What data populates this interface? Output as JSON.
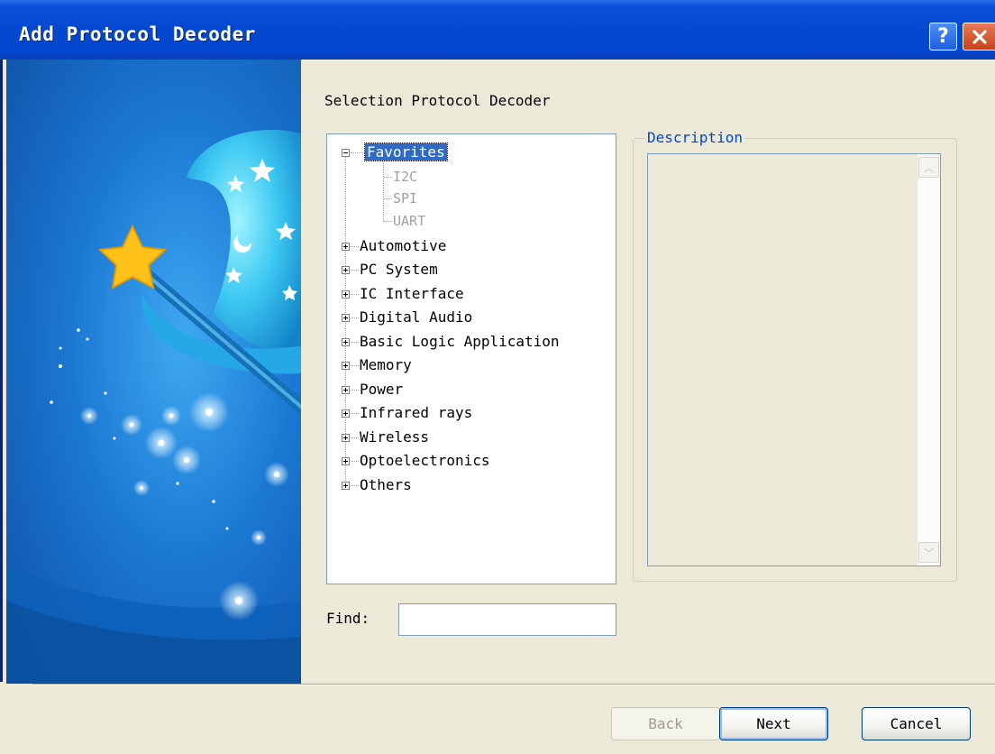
{
  "window": {
    "title": "Add Protocol Decoder",
    "help_icon": "question-mark",
    "close_icon": "x-close",
    "title_color": "#0548d0"
  },
  "banner": {
    "image": "wizard-hat-with-magic-wand-and-stars",
    "background_color": "#1b78d2"
  },
  "main": {
    "heading": "Selection Protocol Decoder",
    "tree": {
      "favorites": {
        "label": "Favorites",
        "expanded": true,
        "selected": true,
        "children": [
          "I2C",
          "SPI",
          "UART"
        ]
      },
      "categories": [
        "Automotive",
        "PC System",
        "IC Interface",
        "Digital Audio",
        "Basic Logic Application",
        "Memory",
        "Power",
        "Infrared rays",
        "Wireless",
        "Optoelectronics",
        "Others"
      ]
    },
    "description": {
      "legend": "Description",
      "text": ""
    },
    "find": {
      "label": "Find:",
      "value": ""
    }
  },
  "footer": {
    "back_label": "Back",
    "back_enabled": false,
    "next_label": "Next",
    "cancel_label": "Cancel"
  }
}
